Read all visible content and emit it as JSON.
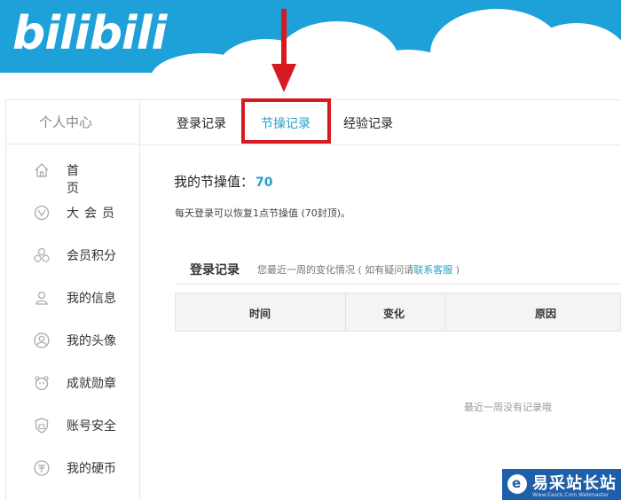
{
  "header": {
    "logo": "bilibili"
  },
  "sidebar": {
    "title": "个人中心",
    "items": [
      {
        "label": "首　页",
        "icon": "home-icon"
      },
      {
        "label": "大会员",
        "icon": "vip-icon"
      },
      {
        "label": "会员积分",
        "icon": "points-icon"
      },
      {
        "label": "我的信息",
        "icon": "user-icon"
      },
      {
        "label": "我的头像",
        "icon": "avatar-icon"
      },
      {
        "label": "成就勋章",
        "icon": "medal-icon"
      },
      {
        "label": "账号安全",
        "icon": "shield-icon"
      },
      {
        "label": "我的硬币",
        "icon": "coin-icon"
      }
    ]
  },
  "tabs": [
    {
      "label": "登录记录"
    },
    {
      "label": "节操记录",
      "active": true
    },
    {
      "label": "经验记录"
    }
  ],
  "main": {
    "value_label": "我的节操值：",
    "value": "70",
    "hint": "每天登录可以恢复1点节操值 (70封顶)。",
    "section_title": "登录记录",
    "section_sub_prefix": "您最近一周的变化情况 ( 如有疑问请",
    "section_sub_link": "联系客服",
    "section_sub_suffix": " )",
    "table_headers": [
      "时间",
      "变化",
      "原因"
    ],
    "empty_text": "最近一周没有记录哦"
  },
  "watermark": {
    "text": "易采站长站",
    "url": "Www.Easck.Com Webmaster"
  },
  "colors": {
    "sky": "#1ea1d8",
    "accent": "#23a0c6",
    "highlight": "#d71920"
  }
}
